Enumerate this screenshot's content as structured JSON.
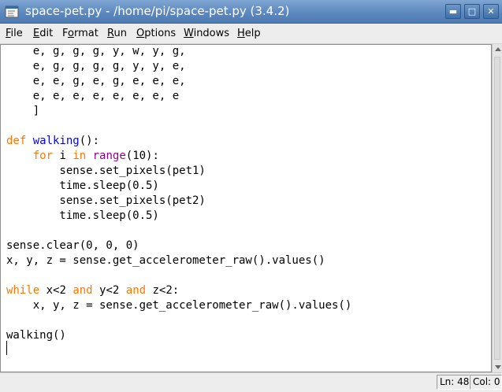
{
  "window": {
    "title": "space-pet.py - /home/pi/space-pet.py (3.4.2)",
    "icon": "python-idle-icon",
    "controls": {
      "minimize": "▬",
      "maximize": "□",
      "close": "✕"
    }
  },
  "menu": {
    "items": [
      {
        "label": "File",
        "access_key": "F"
      },
      {
        "label": "Edit",
        "access_key": "E"
      },
      {
        "label": "Format",
        "access_key": "o"
      },
      {
        "label": "Run",
        "access_key": "R"
      },
      {
        "label": "Options",
        "access_key": "O"
      },
      {
        "label": "Windows",
        "access_key": "W"
      },
      {
        "label": "Help",
        "access_key": "H"
      }
    ]
  },
  "editor": {
    "lines": [
      [
        {
          "t": "    e, g, g, g, y, w, y, g,"
        }
      ],
      [
        {
          "t": "    e, g, g, g, g, y, y, e,"
        }
      ],
      [
        {
          "t": "    e, e, g, e, g, e, e, e,"
        }
      ],
      [
        {
          "t": "    e, e, e, e, e, e, e, e"
        }
      ],
      [
        {
          "t": "    ]"
        }
      ],
      [
        {
          "t": ""
        }
      ],
      [
        {
          "t": "def",
          "c": "kw"
        },
        {
          "t": " "
        },
        {
          "t": "walking",
          "c": "fn"
        },
        {
          "t": "():"
        }
      ],
      [
        {
          "t": "    "
        },
        {
          "t": "for",
          "c": "kw"
        },
        {
          "t": " i "
        },
        {
          "t": "in",
          "c": "kw"
        },
        {
          "t": " "
        },
        {
          "t": "range",
          "c": "bi"
        },
        {
          "t": "(10):"
        }
      ],
      [
        {
          "t": "        sense.set_pixels(pet1)"
        }
      ],
      [
        {
          "t": "        time.sleep(0.5)"
        }
      ],
      [
        {
          "t": "        sense.set_pixels(pet2)"
        }
      ],
      [
        {
          "t": "        time.sleep(0.5)"
        }
      ],
      [
        {
          "t": ""
        }
      ],
      [
        {
          "t": "sense.clear(0, 0, 0)"
        }
      ],
      [
        {
          "t": "x, y, z = sense.get_accelerometer_raw().values()"
        }
      ],
      [
        {
          "t": ""
        }
      ],
      [
        {
          "t": "while",
          "c": "kw"
        },
        {
          "t": " x<2 "
        },
        {
          "t": "and",
          "c": "kw"
        },
        {
          "t": " y<2 "
        },
        {
          "t": "and",
          "c": "kw"
        },
        {
          "t": " z<2:"
        }
      ],
      [
        {
          "t": "    x, y, z = sense.get_accelerometer_raw().values()"
        }
      ],
      [
        {
          "t": ""
        }
      ],
      [
        {
          "t": "walking()"
        }
      ],
      [
        {
          "t": ""
        }
      ]
    ],
    "colors": {
      "keyword": "#ff7700",
      "definition": "#0000ff",
      "builtin": "#900090",
      "text": "#000000",
      "background": "#ffffff"
    }
  },
  "status": {
    "line": "Ln: 48",
    "col": "Col: 0"
  }
}
